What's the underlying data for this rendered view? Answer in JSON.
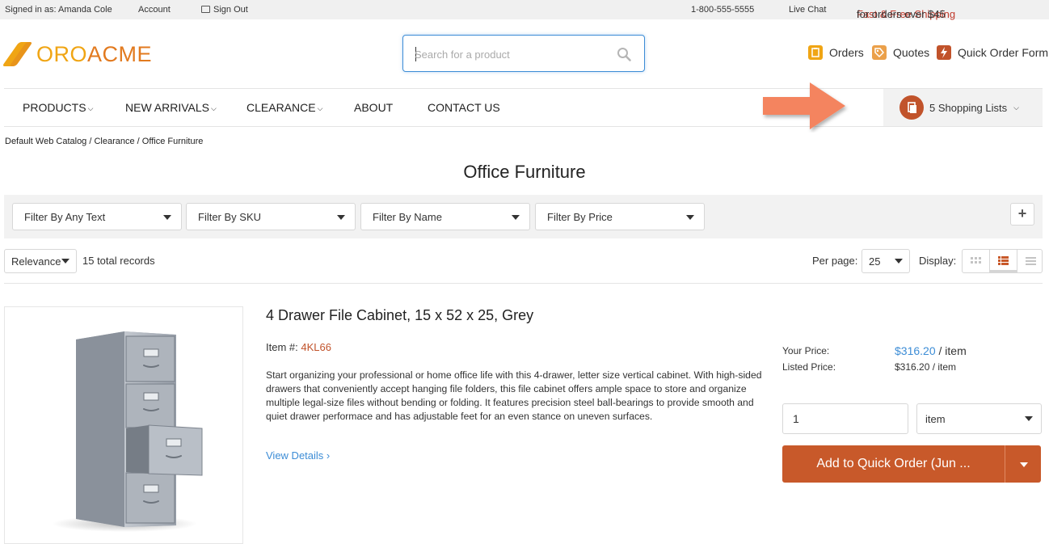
{
  "topbar": {
    "signed_in": "Signed in as: Amanda Cole",
    "account": "Account",
    "sign_out": "Sign Out",
    "phone": "1-800-555-5555",
    "live_chat": "Live Chat",
    "promo_accent": "Fast & Free Shipping",
    "promo_rest": " for orders over $45"
  },
  "logo": {
    "part1": "ORO",
    "part2": "ACME"
  },
  "search": {
    "placeholder": "Search for a product",
    "value": ""
  },
  "header_links": [
    {
      "label": "Orders",
      "icon": "orders-icon"
    },
    {
      "label": "Quotes",
      "icon": "quotes-icon"
    },
    {
      "label": "Quick Order Form",
      "icon": "quick-order-icon"
    }
  ],
  "nav": {
    "items": [
      "PRODUCTS",
      "NEW ARRIVALS",
      "CLEARANCE",
      "ABOUT",
      "CONTACT US"
    ],
    "shopping_lists": "5 Shopping Lists"
  },
  "breadcrumb": "Default Web Catalog / Clearance / Office Furniture",
  "page_title": "Office Furniture",
  "filters": [
    "Filter By Any Text",
    "Filter By SKU",
    "Filter By Name",
    "Filter By Price"
  ],
  "toolbar": {
    "sort": "Relevance",
    "total": "15 total records",
    "per_page_label": "Per page:",
    "per_page_value": "25",
    "display_label": "Display:"
  },
  "product": {
    "name": "4 Drawer File Cabinet, 15 x 52 x 25, Grey",
    "item_label": "Item #:",
    "sku": "4KL66",
    "description": "Start organizing your professional or home office life with this 4-drawer, letter size vertical cabinet. With high-sided drawers that conveniently accept hanging file folders, this file cabinet offers ample space to store and organize multiple legal-size files without bending or folding. It features precision steel ball-bearings to provide smooth and quiet drawer performace and has adjustable feet for an even stance on uneven surfaces.",
    "view_details": "View Details ›",
    "your_price_label": "Your Price:",
    "your_price": "$316.20",
    "your_price_unit": " / item",
    "listed_price_label": "Listed Price:",
    "listed_price": "$316.20 / item",
    "quantity": "1",
    "unit": "item",
    "add_button": "Add to Quick Order (Jun ..."
  },
  "colors": {
    "accent": "#c8592a",
    "link": "#3d8dd6",
    "brand": "#f0a514"
  }
}
